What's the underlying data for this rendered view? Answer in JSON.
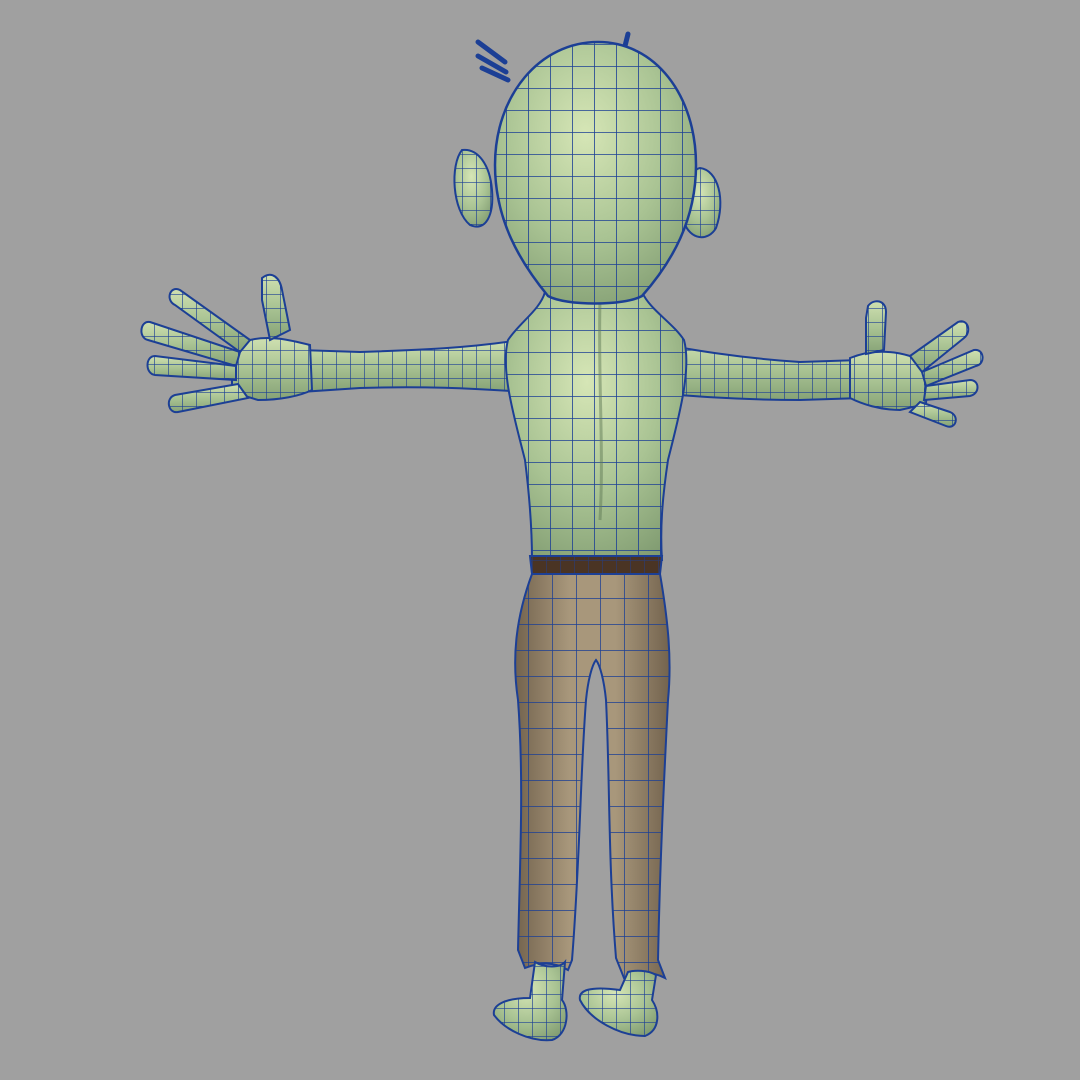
{
  "viewport": {
    "background": "#a0a0a0"
  },
  "model": {
    "view": "back",
    "pose": "t-pose",
    "display": "wireframe-on-shaded",
    "colors": {
      "skin": "#a9c393",
      "skin_shadow": "#7f9a70",
      "skin_highlight": "#d6e6b6",
      "pants": "#9c8a70",
      "pants_shadow": "#73634e",
      "belt": "#4a3424",
      "wire": "#1c3f95"
    }
  }
}
